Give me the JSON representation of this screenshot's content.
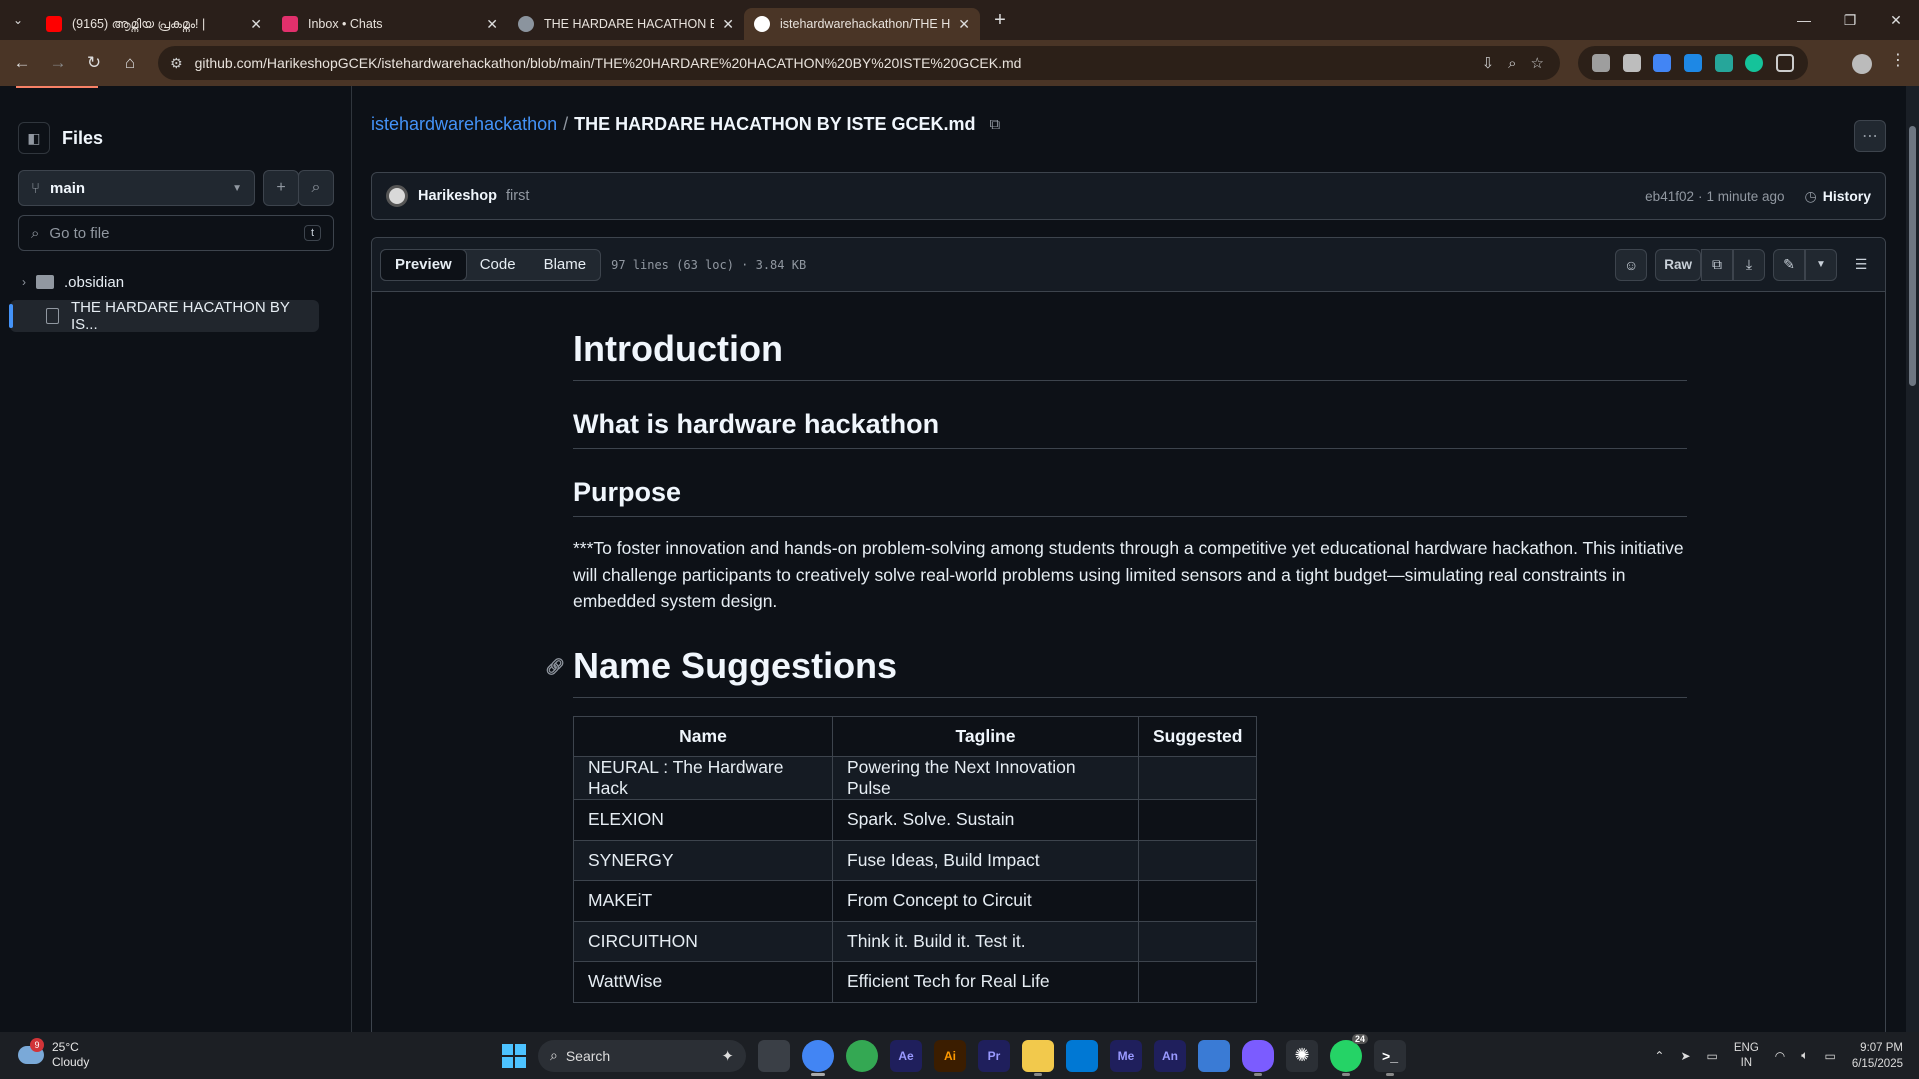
{
  "browser": {
    "tabs": [
      {
        "title": "(9165) ആമ്നിയ പ്രകമ്നം! | ",
        "favicon_color": "#ff0000",
        "active": false
      },
      {
        "title": "Inbox • Chats",
        "favicon_color": "#e1306c",
        "active": false
      },
      {
        "title": "THE HARDARE HACATHON BY I",
        "favicon_color": "#8b949e",
        "active": false
      },
      {
        "title": "istehardwarehackathon/THE HA",
        "favicon_color": "#ffffff",
        "active": true
      }
    ],
    "url": "github.com/HarikeshopGCEK/istehardwarehackathon/blob/main/THE%20HARDARE%20HACATHON%20BY%20ISTE%20GCEK.md"
  },
  "sidebar": {
    "title": "Files",
    "branch": "main",
    "goto_placeholder": "Go to file",
    "goto_shortcut": "t",
    "tree": [
      {
        "name": ".obsidian",
        "type": "folder"
      },
      {
        "name": "THE HARDARE HACATHON BY IS...",
        "type": "file",
        "selected": true
      }
    ]
  },
  "breadcrumb": {
    "repo": "istehardwarehackathon",
    "separator": "/",
    "file": "THE HARDARE HACATHON BY ISTE GCEK.md"
  },
  "commit": {
    "author": "Harikeshop",
    "message": "first",
    "sha": "eb41f02",
    "dot": "·",
    "time": "1 minute ago",
    "history_label": "History"
  },
  "file_header": {
    "tabs": [
      "Preview",
      "Code",
      "Blame"
    ],
    "active_tab": "Preview",
    "meta": "97 lines (63 loc) · 3.84 KB",
    "raw_label": "Raw"
  },
  "content": {
    "h1": "Introduction",
    "h2a": "What is hardware hackathon",
    "h2b": "Purpose",
    "paragraph": "***To foster innovation and hands-on problem-solving among students through a competitive yet educational hardware hackathon. This initiative will challenge participants to creatively solve real-world problems using limited sensors and a tight budget—simulating real constraints in embedded system design.",
    "h1b": "Name Suggestions",
    "table": {
      "headers": [
        "Name",
        "Tagline",
        "Suggested"
      ],
      "rows": [
        [
          "NEURAL : The Hardware Hack",
          "Powering the Next Innovation Pulse",
          ""
        ],
        [
          "ELEXION",
          "Spark. Solve. Sustain",
          ""
        ],
        [
          "SYNERGY",
          "Fuse Ideas, Build Impact",
          ""
        ],
        [
          "MAKEiT",
          "From Concept to Circuit",
          ""
        ],
        [
          "CIRCUITHON",
          "Think it. Build it. Test it.",
          ""
        ],
        [
          "WattWise",
          "Efficient Tech for Real Life",
          ""
        ]
      ]
    }
  },
  "taskbar": {
    "weather_temp": "25°C",
    "weather_desc": "Cloudy",
    "weather_badge": "9",
    "search_label": "Search",
    "whatsapp_count": "24",
    "lang_top": "ENG",
    "lang_bottom": "IN",
    "time": "9:07 PM",
    "date": "6/15/2025",
    "apps": [
      {
        "label": "",
        "color": "#3a3f46",
        "name": "task-view"
      },
      {
        "label": "",
        "color": "#4285f4",
        "name": "chrome"
      },
      {
        "label": "",
        "color": "#34a853",
        "name": "chrome-2"
      },
      {
        "label": "Ae",
        "color": "#1f1f5c",
        "name": "after-effects"
      },
      {
        "label": "Ai",
        "color": "#3b1d00",
        "name": "illustrator"
      },
      {
        "label": "Pr",
        "color": "#1f1f5c",
        "name": "premiere"
      },
      {
        "label": "",
        "color": "#f2c94c",
        "name": "file-explorer"
      },
      {
        "label": "",
        "color": "#0078d4",
        "name": "store"
      },
      {
        "label": "Me",
        "color": "#1f1f5c",
        "name": "media-encoder"
      },
      {
        "label": "An",
        "color": "#1f1f5c",
        "name": "animate"
      },
      {
        "label": "",
        "color": "#3a7bd5",
        "name": "photos"
      },
      {
        "label": "",
        "color": "#7b5cff",
        "name": "obsidian"
      },
      {
        "label": "",
        "color": "#2b2f35",
        "name": "chatgpt"
      },
      {
        "label": "",
        "color": "#25d366",
        "name": "whatsapp"
      },
      {
        "label": "",
        "color": "#2b2f35",
        "name": "terminal"
      }
    ]
  }
}
